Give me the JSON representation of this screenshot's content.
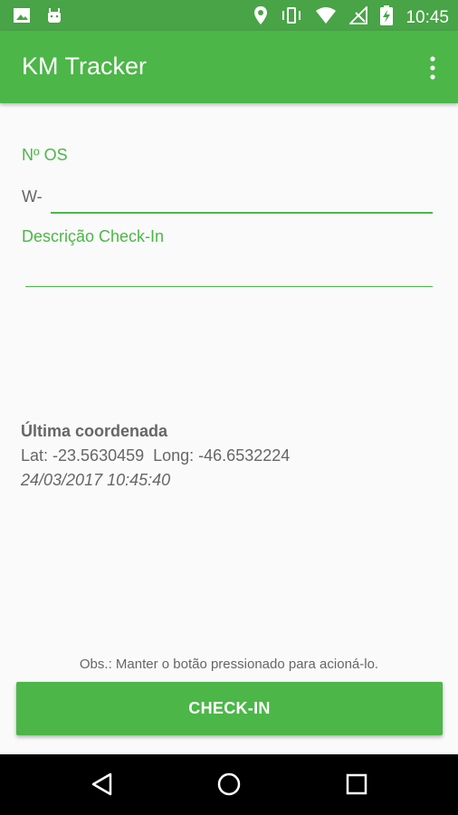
{
  "status_bar": {
    "time": "10:45",
    "icons": [
      "image-icon",
      "android-icon",
      "location-icon",
      "vibrate-icon",
      "wifi-icon",
      "no-signal-icon",
      "battery-charging-icon"
    ]
  },
  "app_bar": {
    "title": "KM Tracker",
    "menu_icon": "more-vert-icon"
  },
  "form": {
    "os_label": "Nº OS",
    "os_prefix": "W-",
    "os_value": "",
    "description_label": "Descrição Check-In",
    "description_value": ""
  },
  "coordinates": {
    "title": "Última coordenada",
    "line": "Lat: -23.5630459  Long: -46.6532224",
    "timestamp": "24/03/2017 10:45:40"
  },
  "footer": {
    "note": "Obs.: Manter o botão pressionado para acioná-lo.",
    "checkin_label": "CHECK-IN"
  },
  "navigation": {
    "icons": [
      "back-icon",
      "home-icon",
      "recents-icon"
    ]
  },
  "colors": {
    "primary": "#4cb648",
    "status_bar": "#49a347",
    "text": "#666666"
  }
}
